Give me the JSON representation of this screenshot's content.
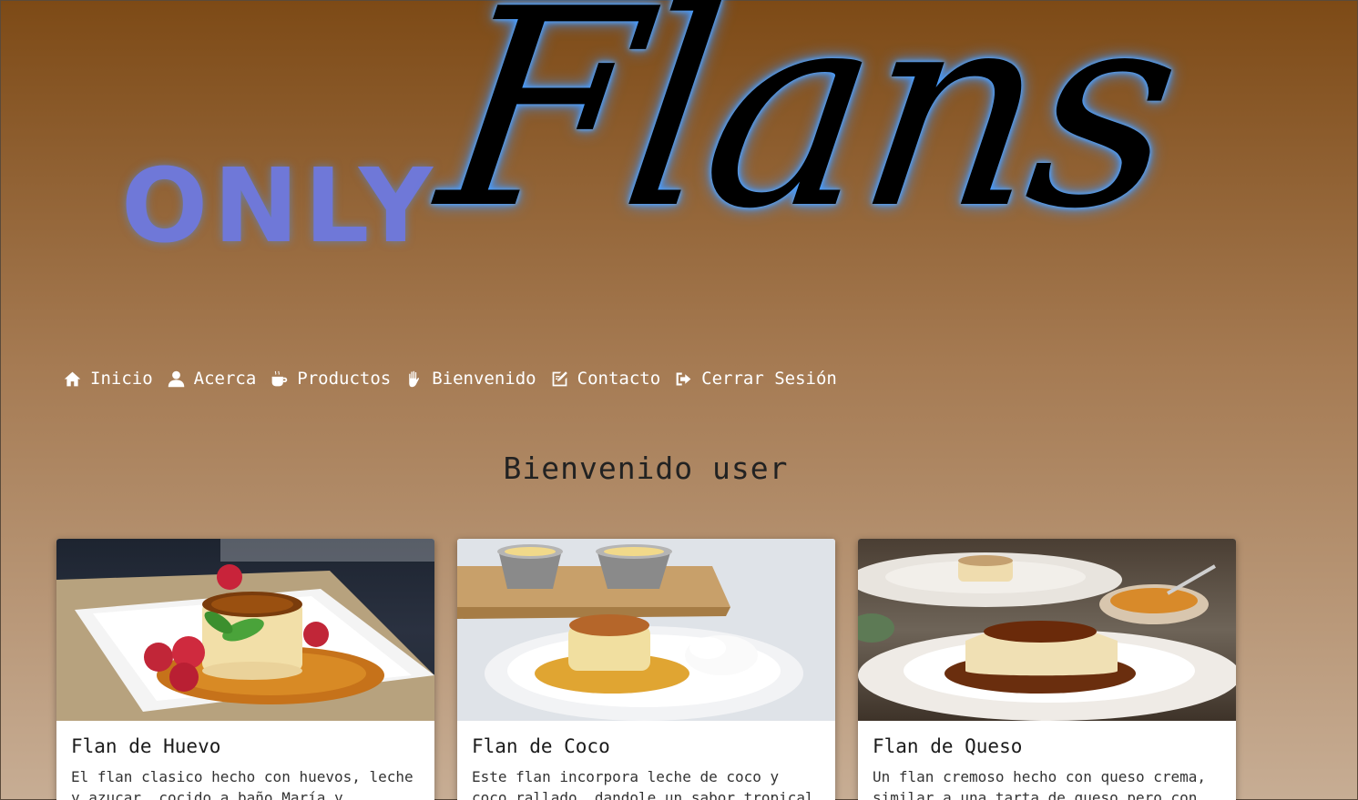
{
  "logo": {
    "only": "ONLY",
    "flans": "Flans"
  },
  "nav": {
    "items": [
      {
        "label": "Inicio",
        "icon": "home-icon"
      },
      {
        "label": "Acerca",
        "icon": "user-icon"
      },
      {
        "label": "Productos",
        "icon": "coffee-icon"
      },
      {
        "label": "Bienvenido",
        "icon": "hand-icon"
      },
      {
        "label": "Contacto",
        "icon": "edit-icon"
      },
      {
        "label": "Cerrar Sesión",
        "icon": "sign-out-icon"
      }
    ]
  },
  "welcome": {
    "title": "Bienvenido user"
  },
  "cards": [
    {
      "title": "Flan de Huevo",
      "text": "El flan clasico hecho con huevos, leche y azucar, cocido a baño María y"
    },
    {
      "title": "Flan de Coco",
      "text": "Este flan incorpora leche de coco y coco rallado, dandole un sabor tropical"
    },
    {
      "title": "Flan de Queso",
      "text": "Un flan cremoso hecho con queso crema, similar a una tarta de queso pero con"
    }
  ],
  "colors": {
    "header_top": "#7d4a16",
    "header_bottom": "#c7ad94",
    "only_text": "#6f78d8",
    "glow": "#4aa0ff",
    "caramel": "#c07a1c"
  }
}
